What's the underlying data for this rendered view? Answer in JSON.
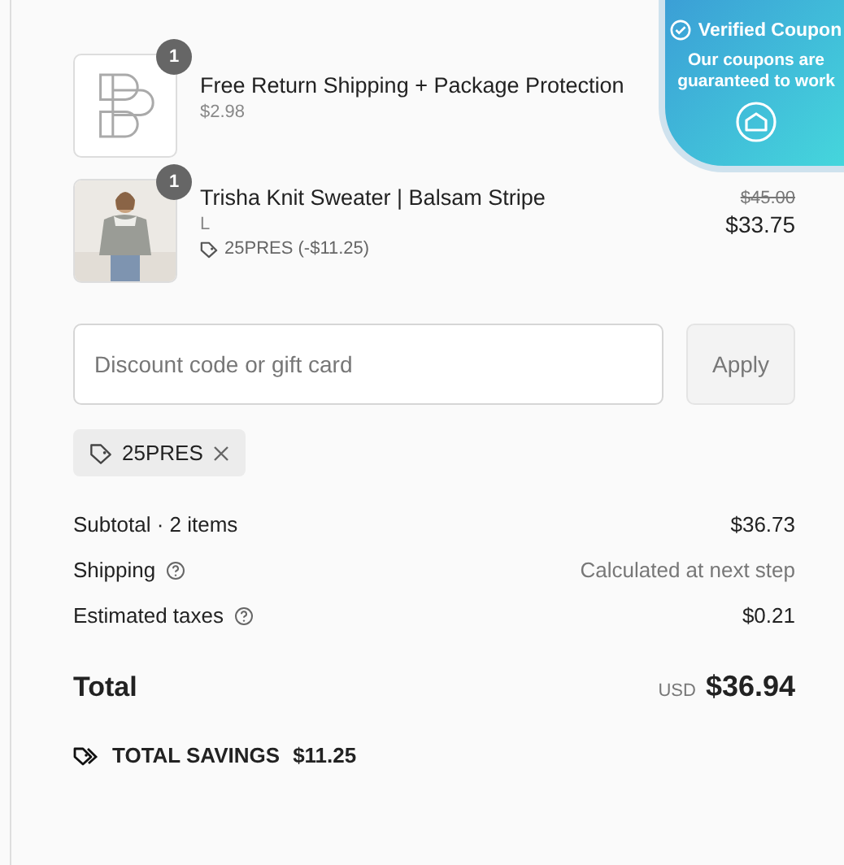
{
  "line_items": [
    {
      "kind": "logo",
      "quantity": "1",
      "title": "Free Return Shipping + Package Protection",
      "subtitle": "$2.98"
    },
    {
      "kind": "picture",
      "quantity": "1",
      "title": "Trisha Knit Sweater | Balsam Stripe",
      "subtitle": "L",
      "discount": "25PRES (-$11.25)",
      "original_price": "$45.00",
      "price": "$33.75"
    }
  ],
  "discount_field": {
    "placeholder": "Discount code or gift card",
    "button": "Apply"
  },
  "applied_codes": [
    {
      "code": "25PRES"
    }
  ],
  "summary": [
    {
      "label": "Subtotal · 2 items",
      "value": "$36.73",
      "help": false,
      "muted": false
    },
    {
      "label": "Shipping",
      "value": "Calculated at next step",
      "help": true,
      "muted": true
    },
    {
      "label": "Estimated taxes",
      "value": "$0.21",
      "help": true,
      "muted": false
    }
  ],
  "total": {
    "label": "Total",
    "currency": "USD",
    "amount": "$36.94"
  },
  "savings": {
    "label": "TOTAL SAVINGS",
    "amount": "$11.25"
  },
  "coupon_badge": {
    "title": "Verified Coupon",
    "text": "Our coupons are guaranteed to work"
  }
}
